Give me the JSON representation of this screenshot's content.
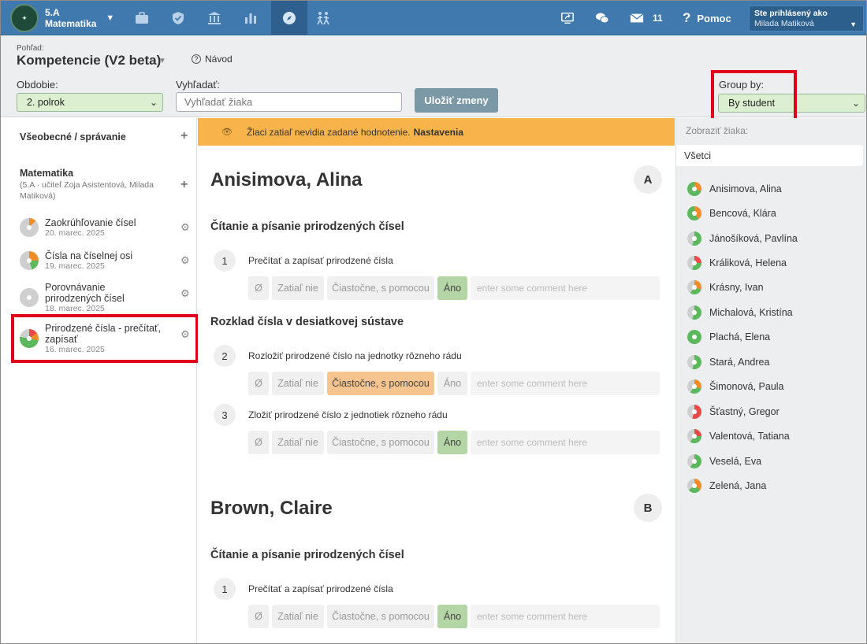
{
  "topbar": {
    "class_name": "5.A",
    "subject": "Matematika",
    "nav_icons": [
      "briefcase-icon",
      "shield-icon",
      "bank-icon",
      "bar-chart-icon",
      "compass-icon",
      "students-walking-icon"
    ],
    "message_count": "11",
    "help_label": "Pomoc",
    "logged_in_label": "Ste prihlásený ako",
    "user_name": "Milada Matiková"
  },
  "header": {
    "view_caption": "Pohľad:",
    "view_title": "Kompetencie (V2 beta)",
    "guide_label": "Návod",
    "period_label": "Obdobie:",
    "period_value": "2. polrok",
    "search_label": "Vyhľadať:",
    "search_placeholder": "Vyhľadať žiaka",
    "save_label": "Uložiť zmeny",
    "group_label": "Group by:",
    "group_value": "By student"
  },
  "sidebar": {
    "general_title": "Všeobecné / správanie",
    "subject_title": "Matematika",
    "subject_sub": "(5.A · učiteľ Zoja Asistentová, Milada Matiková)",
    "lessons": [
      {
        "title": "Zaokrúhľovanie čísel",
        "date": "20. marec. 2025"
      },
      {
        "title": "Čísla na číselnej osi",
        "date": "19. marec. 2025"
      },
      {
        "title": "Porovnávanie prirodzených čísel",
        "date": "18. marec. 2025"
      },
      {
        "title": "Prirodzené čísla - prečítať, zapísať",
        "date": "16. marec. 2025"
      }
    ]
  },
  "banner": {
    "text": "Žiaci zatiaľ nevidia zadané hodnotenie.",
    "link": "Nastavenia"
  },
  "options": {
    "empty": "Ø",
    "no": "Zatiaľ nie",
    "partial": "Čiastočne, s pomocou",
    "yes": "Áno",
    "comment_placeholder": "enter some comment here"
  },
  "students_main": [
    {
      "name": "Anisimova, Alina",
      "letter": "A",
      "topic1": "Čítanie a písanie prirodzených čísel",
      "c1": {
        "num": "1",
        "text": "Prečítať a zapísať prirodzené čísla",
        "selected": "yes"
      },
      "topic2": "Rozklad čísla v desiatkovej sústave",
      "c2": {
        "num": "2",
        "text": "Rozložiť prirodzené číslo na jednotky rôzneho rádu",
        "selected": "partial"
      },
      "c3": {
        "num": "3",
        "text": "Zložiť prirodzené číslo z jednotiek rôzneho rádu",
        "selected": "yes"
      }
    },
    {
      "name": "Brown, Claire",
      "letter": "B",
      "topic1": "Čítanie a písanie prirodzených čísel",
      "c1": {
        "num": "1",
        "text": "Prečítať a zapísať prirodzené čísla",
        "selected": "yes"
      }
    }
  ],
  "right": {
    "show_label": "Zobraziť žiaka:",
    "filter_value": "Všetci",
    "students": [
      "Anisimova, Alina",
      "Bencová, Klára",
      "Jánošíková, Pavlína",
      "Králiková, Helena",
      "Krásny, Ivan",
      "Michalová, Kristína",
      "Plachá, Elena",
      "Stará, Andrea",
      "Šimonová, Paula",
      "Šťastný, Gregor",
      "Valentová, Tatiana",
      "Veselá, Eva",
      "Zelená, Jana"
    ]
  },
  "colors": {
    "topbar": "#3f79ad",
    "banner": "#f8b44a",
    "yes": "#b4d5a5",
    "partial": "#f6c58f",
    "highlight": "#e0001b"
  }
}
